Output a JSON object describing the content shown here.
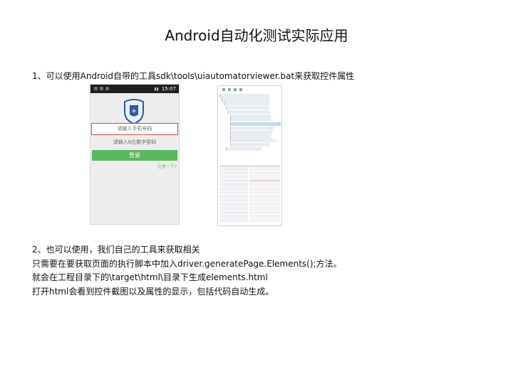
{
  "slide": {
    "title": "Android自动化测试实际应用",
    "line1": "1、可以使用Android自带的工具sdk\\tools\\uiautomatorviewer.bat来获取控件属性",
    "line2": "2、也可以使用，我们自己的工具来获取相关",
    "line3": "只需要在要获取页面的执行脚本中加入driver.generatePage.Elements();方法。",
    "line4": "就会在工程目录下的\\target\\html\\目录下生成elements.html",
    "line5": "打开html会看到控件截图以及属性的显示，包括代码自动生成。"
  },
  "phone": {
    "time": "15:07",
    "username_placeholder": "请输入手机号码",
    "password_placeholder": "请输入6位数字密码",
    "login_label": "登录",
    "register_link": "注册一下?"
  }
}
